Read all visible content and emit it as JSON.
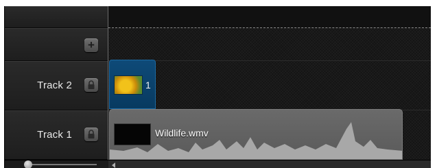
{
  "tracks": [
    {
      "label": "Track 2",
      "clip_label": "1"
    },
    {
      "label": "Track 1",
      "clip_label": "Wildlife.wmv"
    }
  ],
  "icons": {
    "add_track": "plus-icon",
    "lock": "lock-icon",
    "scroll_left": "arrow-left-icon"
  },
  "colors": {
    "selected_clip": "#0e4a78",
    "audio_clip": "#6a6a6a",
    "waveform": "#a8a8a8"
  }
}
